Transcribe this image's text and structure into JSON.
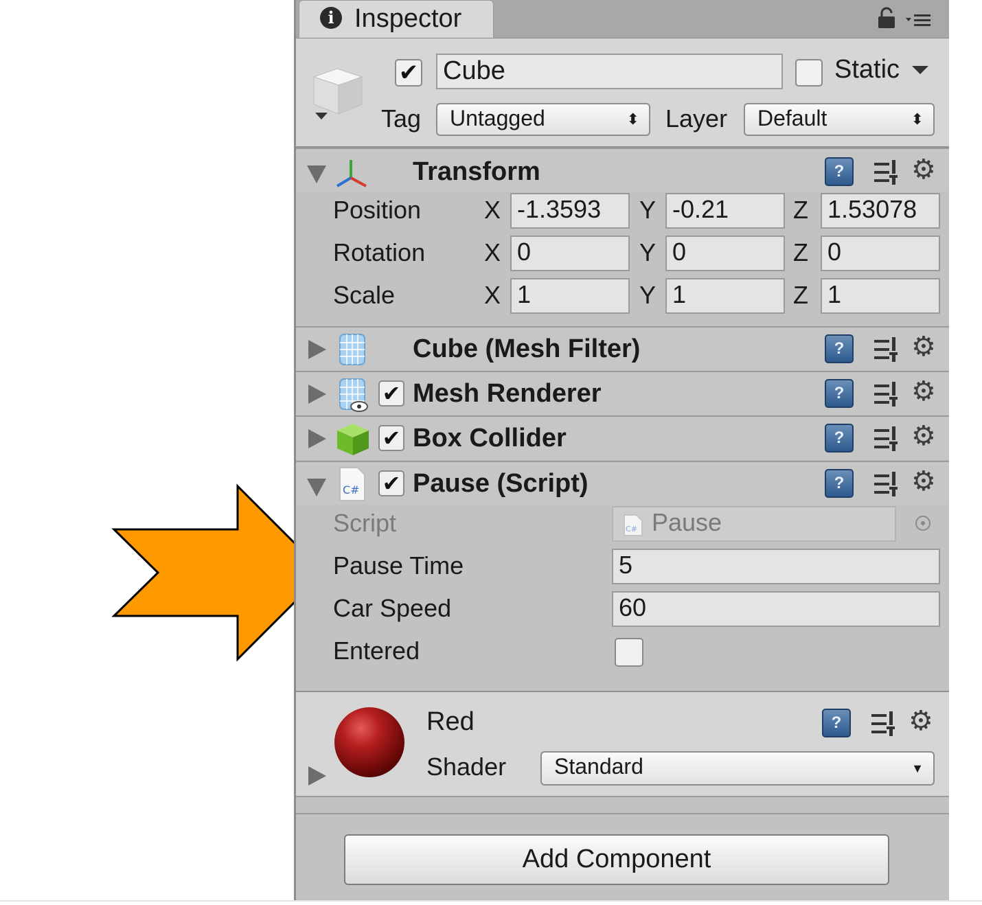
{
  "inspector": {
    "tab_label": "Inspector",
    "object": {
      "name": "Cube",
      "active": true,
      "static_label": "Static",
      "static": false,
      "tag_label": "Tag",
      "tag_value": "Untagged",
      "layer_label": "Layer",
      "layer_value": "Default"
    },
    "transform": {
      "title": "Transform",
      "position_label": "Position",
      "rotation_label": "Rotation",
      "scale_label": "Scale",
      "axis_x": "X",
      "axis_y": "Y",
      "axis_z": "Z",
      "position": {
        "x": "-1.3593",
        "y": "-0.21",
        "z": "1.53078"
      },
      "rotation": {
        "x": "0",
        "y": "0",
        "z": "0"
      },
      "scale": {
        "x": "1",
        "y": "1",
        "z": "1"
      }
    },
    "components": {
      "mesh_filter": "Cube (Mesh Filter)",
      "mesh_renderer": "Mesh Renderer",
      "box_collider": "Box Collider",
      "pause_script": "Pause (Script)"
    },
    "pause": {
      "script_label": "Script",
      "script_value": "Pause",
      "pause_time_label": "Pause Time",
      "pause_time_value": "5",
      "car_speed_label": "Car Speed",
      "car_speed_value": "60",
      "entered_label": "Entered",
      "entered": false
    },
    "material": {
      "name": "Red",
      "shader_label": "Shader",
      "shader_value": "Standard",
      "color": "#b51f1f"
    },
    "add_component_label": "Add Component"
  },
  "annotation": {
    "arrow_color": "#ff9900"
  }
}
